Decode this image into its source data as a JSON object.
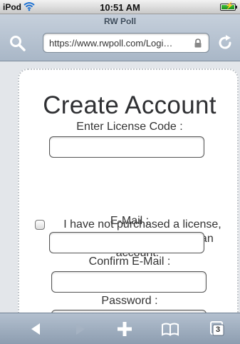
{
  "status_bar": {
    "carrier": "iPod",
    "time": "10:51 AM"
  },
  "browser": {
    "page_title": "RW Poll",
    "url": "https://www.rwpoll.com/Logi…"
  },
  "form": {
    "heading": "Create Account",
    "license_label": "Enter License Code :",
    "license_value": "",
    "checkbox_line1": "I have not purchased a license,",
    "checkbox_line2": "but would still like to create an",
    "checkbox_line3": "account.",
    "checkbox_checked": false,
    "email_label": "E-Mail :",
    "email_value": "",
    "confirm_email_label": "Confirm E-Mail :",
    "confirm_email_value": "",
    "password_label": "Password :",
    "password_value": ""
  },
  "toolbar": {
    "tabs_count": "3",
    "icons": [
      "back-icon",
      "forward-icon",
      "add-icon",
      "bookmarks-icon",
      "tabs-icon"
    ]
  },
  "colors": {
    "chrome": "#a9b7c7",
    "toolbar": "#8d9db0",
    "battery": "#2aa52a"
  }
}
